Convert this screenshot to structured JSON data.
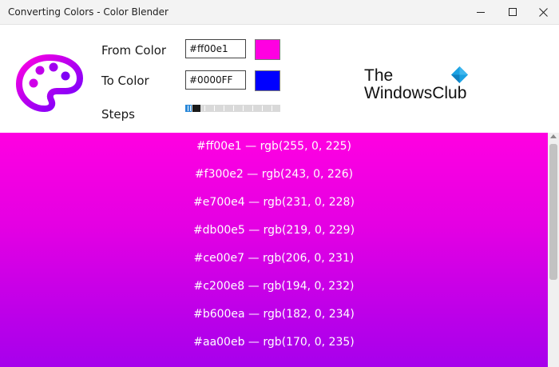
{
  "window": {
    "title": "Converting Colors - Color Blender",
    "controls": [
      "minimize",
      "maximize",
      "close"
    ]
  },
  "form": {
    "from_label": "From Color",
    "from_value": "#ff00e1",
    "from_swatch": "#ff00e1",
    "to_label": "To Color",
    "to_value": "#0000FF",
    "to_swatch": "#0000ff",
    "steps_label": "Steps"
  },
  "branding": {
    "line1": "The",
    "line2": "WindowsClub",
    "icon": "windows-logo-icon"
  },
  "logo_icon": "palette-icon",
  "results": [
    {
      "text": "#ff00e1 — rgb(255, 0, 225)"
    },
    {
      "text": "#f300e2 — rgb(243, 0, 226)"
    },
    {
      "text": "#e700e4 — rgb(231, 0, 228)"
    },
    {
      "text": "#db00e5 — rgb(219, 0, 229)"
    },
    {
      "text": "#ce00e7 — rgb(206, 0, 231)"
    },
    {
      "text": "#c200e8 — rgb(194, 0, 232)"
    },
    {
      "text": "#b600ea — rgb(182, 0, 234)"
    },
    {
      "text": "#aa00eb — rgb(170, 0, 235)"
    }
  ],
  "colors": {
    "gradient_start": "#ff00e1",
    "gradient_end": "#a700ec",
    "accent": "#2b88d8"
  }
}
